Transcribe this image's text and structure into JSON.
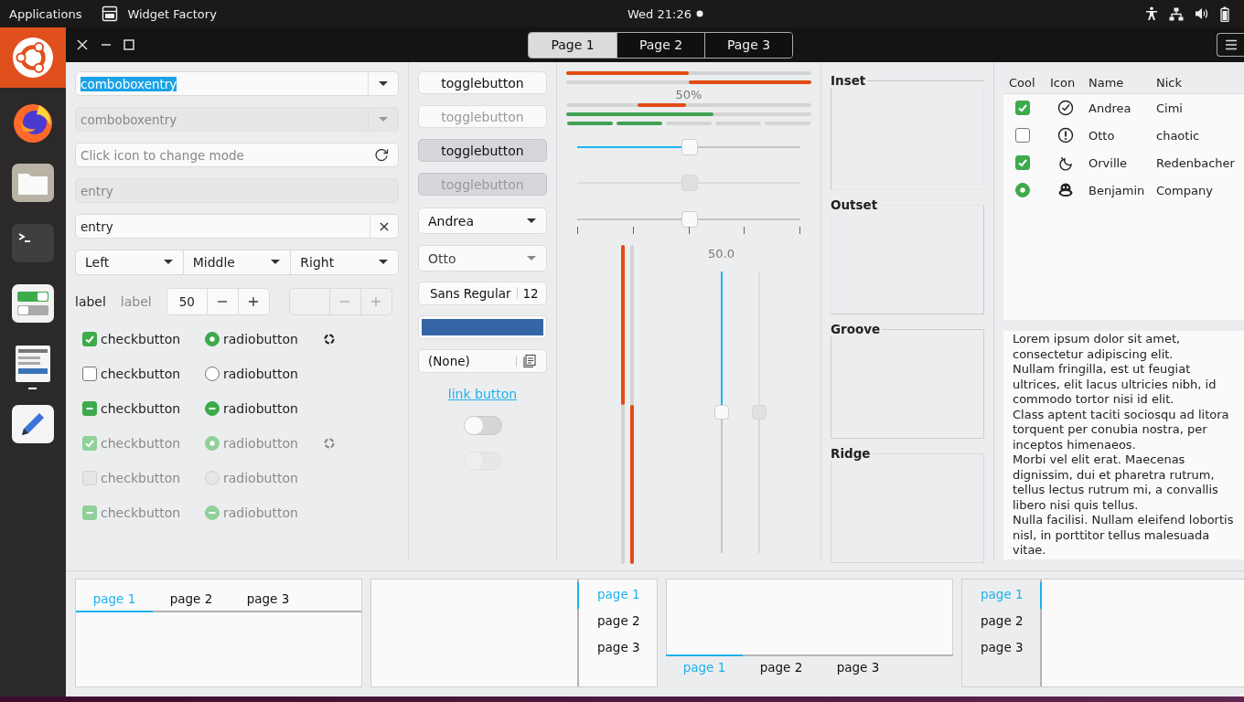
{
  "top_bar": {
    "menu": "Applications",
    "app_name": "Widget Factory",
    "clock": "Wed 21:26",
    "notification": true
  },
  "dock": [
    {
      "kind": "ubuntu",
      "selected": true,
      "running": false
    },
    {
      "kind": "browser",
      "selected": false,
      "running": false
    },
    {
      "kind": "files",
      "selected": false,
      "running": false
    },
    {
      "kind": "terminal",
      "selected": false,
      "running": false
    },
    {
      "kind": "toggles",
      "selected": false,
      "running": false
    },
    {
      "kind": "widget-factory",
      "selected": false,
      "running": true
    },
    {
      "kind": "editor",
      "selected": false,
      "running": false
    }
  ],
  "header": {
    "tabs": [
      {
        "label": "Page 1",
        "selected": true
      },
      {
        "label": "Page 2",
        "selected": false
      },
      {
        "label": "Page 3",
        "selected": false
      }
    ]
  },
  "entries_column": {
    "entries": [
      {
        "kind": "combo",
        "value": "comboboxentry",
        "text_selected": true,
        "disabled": false
      },
      {
        "kind": "combo",
        "value": "comboboxentry",
        "text_selected": false,
        "disabled": true
      },
      {
        "kind": "mode",
        "placeholder": "Click icon to change mode",
        "disabled": false
      },
      {
        "kind": "plain",
        "value": "entry",
        "text_selected": false,
        "disabled": true
      },
      {
        "kind": "clear",
        "value": "entry",
        "text_selected": false,
        "disabled": false
      }
    ],
    "aligned_combos": [
      {
        "label": "Left"
      },
      {
        "label": "Middle"
      },
      {
        "label": "Right"
      }
    ],
    "labels": [
      {
        "text": "label",
        "disabled": false
      },
      {
        "text": "label",
        "disabled": true
      }
    ],
    "spins": [
      {
        "value": "50",
        "disabled": false
      },
      {
        "disabled": true
      }
    ],
    "option_rows": [
      {
        "check": {
          "label": "checkbutton",
          "checked": true,
          "inconsistent": false,
          "disabled": false
        },
        "radio": {
          "label": "radiobutton",
          "checked": true,
          "inconsistent": false,
          "disabled": false
        },
        "spinner": {
          "disabled": false
        }
      },
      {
        "check": {
          "label": "checkbutton",
          "checked": false,
          "inconsistent": false,
          "disabled": false
        },
        "radio": {
          "label": "radiobutton",
          "checked": false,
          "inconsistent": false,
          "disabled": false
        }
      },
      {
        "check": {
          "label": "checkbutton",
          "checked": false,
          "inconsistent": true,
          "disabled": false
        },
        "radio": {
          "label": "radiobutton",
          "checked": false,
          "inconsistent": true,
          "disabled": false
        }
      },
      {
        "check": {
          "label": "checkbutton",
          "checked": true,
          "inconsistent": false,
          "disabled": true
        },
        "radio": {
          "label": "radiobutton",
          "checked": true,
          "inconsistent": false,
          "disabled": true
        },
        "spinner": {
          "disabled": true
        }
      },
      {
        "check": {
          "label": "checkbutton",
          "checked": false,
          "inconsistent": false,
          "disabled": true
        },
        "radio": {
          "label": "radiobutton",
          "checked": false,
          "inconsistent": false,
          "disabled": true
        }
      },
      {
        "check": {
          "label": "checkbutton",
          "checked": false,
          "inconsistent": true,
          "disabled": true
        },
        "radio": {
          "label": "radiobutton",
          "checked": false,
          "inconsistent": true,
          "disabled": true
        }
      }
    ]
  },
  "buttons_column": {
    "toggles": [
      {
        "label": "togglebutton",
        "active": false,
        "disabled": false
      },
      {
        "label": "togglebutton",
        "active": false,
        "disabled": true
      },
      {
        "label": "togglebutton",
        "active": true,
        "disabled": false
      },
      {
        "label": "togglebutton",
        "active": true,
        "disabled": true
      }
    ],
    "combos": [
      {
        "value": "Andrea",
        "disabled": false
      },
      {
        "value": "Otto",
        "disabled": true
      }
    ],
    "font_button": {
      "family": "Sans Regular",
      "size": "12"
    },
    "file_button": {
      "label": "(None)"
    },
    "link": "link button",
    "switches": [
      {
        "on": false,
        "disabled": false
      },
      {
        "on": false,
        "disabled": true
      }
    ]
  },
  "ranges_column": {
    "progress": [
      {
        "level": 0.5,
        "inverted": false
      },
      {
        "level": 0.5,
        "inverted": true
      }
    ],
    "progress_text": "50%",
    "level_bars": [
      {
        "kind": "continuous",
        "level": 0.6
      },
      {
        "kind": "discrete",
        "level": 0.4
      }
    ],
    "sliders": [
      {
        "kind": "fill",
        "level": 0.5,
        "disabled": false
      },
      {
        "kind": "fill",
        "level": 0.5,
        "disabled": true
      },
      {
        "kind": "marks",
        "level": 0.5,
        "disabled": false
      }
    ],
    "vertical_progress": [
      {
        "level": 0.5,
        "inverted": false
      },
      {
        "level": 0.5,
        "inverted": true
      }
    ],
    "vscale_reading": "50.0",
    "vscales": [
      {
        "level": 0.5,
        "disabled": false
      },
      {
        "level": 0.5,
        "disabled": true
      }
    ]
  },
  "frames": [
    {
      "label": "Inset",
      "kind": "inset"
    },
    {
      "label": "Outset",
      "kind": "outset"
    },
    {
      "label": "Groove",
      "kind": "groove"
    },
    {
      "label": "Ridge",
      "kind": "ridge"
    }
  ],
  "tree": {
    "columns": [
      "Cool",
      "Icon",
      "Name",
      "Nick"
    ],
    "rows": [
      {
        "cool": {
          "kind": "check",
          "checked": true
        },
        "name": "Andrea",
        "nick": "Cimi"
      },
      {
        "cool": {
          "kind": "check",
          "checked": false
        },
        "name": "Otto",
        "nick": "chaotic"
      },
      {
        "cool": {
          "kind": "check",
          "checked": true
        },
        "name": "Orville",
        "nick": "Redenbacher"
      },
      {
        "cool": {
          "kind": "radio",
          "checked": true
        },
        "name": "Benjamin",
        "nick": "Company"
      }
    ]
  },
  "text_view": [
    "Lorem ipsum dolor sit amet, consectetur adipiscing elit.",
    "Nullam fringilla, est ut feugiat ultrices, elit lacus ultricies nibh, id commodo tortor nisi id elit.",
    "Class aptent taciti sociosqu ad litora torquent per conubia nostra, per inceptos himenaeos.",
    "Morbi vel elit erat. Maecenas dignissim, dui et pharetra rutrum, tellus lectus rutrum mi, a convallis libero nisi quis tellus.",
    "Nulla facilisi. Nullam eleifend lobortis nisl, in porttitor tellus malesuada vitae."
  ],
  "notebooks": [
    {
      "kind": "top",
      "tabs": [
        {
          "label": "page 1",
          "selected": true
        },
        {
          "label": "page 2",
          "selected": false
        },
        {
          "label": "page 3",
          "selected": false
        }
      ]
    },
    {
      "kind": "right",
      "tabs": [
        {
          "label": "page 1",
          "selected": true
        },
        {
          "label": "page 2",
          "selected": false
        },
        {
          "label": "page 3",
          "selected": false
        }
      ]
    },
    {
      "kind": "bottom",
      "tabs": [
        {
          "label": "page 1",
          "selected": true
        },
        {
          "label": "page 2",
          "selected": false
        },
        {
          "label": "page 3",
          "selected": false
        }
      ]
    },
    {
      "kind": "left",
      "tabs": [
        {
          "label": "page 1",
          "selected": true
        },
        {
          "label": "page 2",
          "selected": false
        },
        {
          "label": "page 3",
          "selected": false
        }
      ]
    }
  ]
}
